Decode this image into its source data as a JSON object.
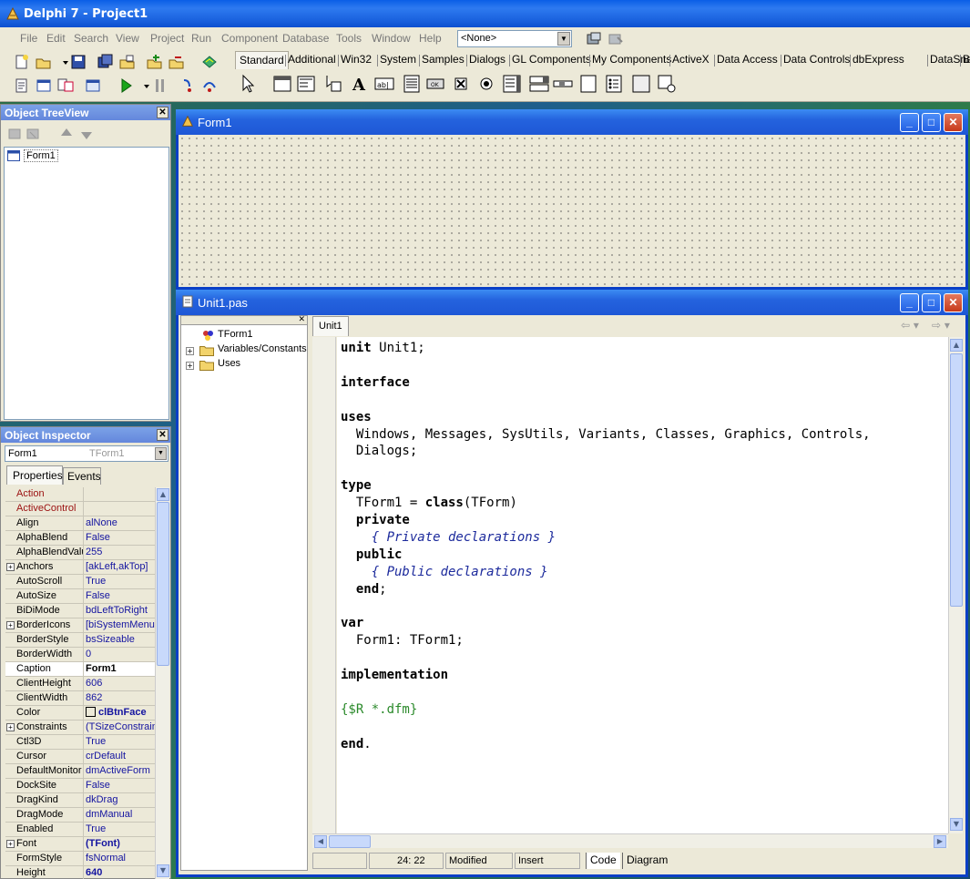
{
  "ide": {
    "title": "Delphi 7 - Project1",
    "menu": [
      "File",
      "Edit",
      "Search",
      "View",
      "Project",
      "Run",
      "Component",
      "Database",
      "Tools",
      "Window",
      "Help"
    ],
    "config_combo": "<None>",
    "palette_tabs": [
      "Standard",
      "Additional",
      "Win32",
      "System",
      "Samples",
      "Dialogs",
      "GL Components",
      "My Components",
      "ActiveX",
      "Data Access",
      "Data Controls",
      "dbExpress",
      "DataSnap",
      "B"
    ]
  },
  "tree_view": {
    "title": "Object TreeView",
    "root": "Form1"
  },
  "inspector": {
    "title": "Object Inspector",
    "object_name": "Form1",
    "object_type": "TForm1",
    "tab_properties": "Properties",
    "tab_events": "Events",
    "rows": [
      {
        "name": "Action",
        "value": "",
        "expand": false,
        "red": true
      },
      {
        "name": "ActiveControl",
        "value": "",
        "expand": false,
        "red": true
      },
      {
        "name": "Align",
        "value": "alNone",
        "expand": false
      },
      {
        "name": "AlphaBlend",
        "value": "False",
        "expand": false
      },
      {
        "name": "AlphaBlendValu",
        "value": "255",
        "expand": false
      },
      {
        "name": "Anchors",
        "value": "[akLeft,akTop]",
        "expand": true
      },
      {
        "name": "AutoScroll",
        "value": "True",
        "expand": false
      },
      {
        "name": "AutoSize",
        "value": "False",
        "expand": false
      },
      {
        "name": "BiDiMode",
        "value": "bdLeftToRight",
        "expand": false
      },
      {
        "name": "BorderIcons",
        "value": "[biSystemMenu,",
        "expand": true
      },
      {
        "name": "BorderStyle",
        "value": "bsSizeable",
        "expand": false
      },
      {
        "name": "BorderWidth",
        "value": "0",
        "expand": false
      },
      {
        "name": "Caption",
        "value": "Form1",
        "expand": false,
        "selected": true
      },
      {
        "name": "ClientHeight",
        "value": "606",
        "expand": false
      },
      {
        "name": "ClientWidth",
        "value": "862",
        "expand": false
      },
      {
        "name": "Color",
        "value": "clBtnFace",
        "expand": false,
        "bold": true,
        "swatch": true
      },
      {
        "name": "Constraints",
        "value": "(TSizeConstrain",
        "expand": true
      },
      {
        "name": "Ctl3D",
        "value": "True",
        "expand": false
      },
      {
        "name": "Cursor",
        "value": "crDefault",
        "expand": false
      },
      {
        "name": "DefaultMonitor",
        "value": "dmActiveForm",
        "expand": false
      },
      {
        "name": "DockSite",
        "value": "False",
        "expand": false
      },
      {
        "name": "DragKind",
        "value": "dkDrag",
        "expand": false
      },
      {
        "name": "DragMode",
        "value": "dmManual",
        "expand": false
      },
      {
        "name": "Enabled",
        "value": "True",
        "expand": false
      },
      {
        "name": "Font",
        "value": "(TFont)",
        "expand": true,
        "bold": true
      },
      {
        "name": "FormStyle",
        "value": "fsNormal",
        "expand": false
      },
      {
        "name": "Height",
        "value": "640",
        "expand": false,
        "bold": true
      }
    ]
  },
  "form_window": {
    "title": "Form1"
  },
  "editor": {
    "title": "Unit1.pas",
    "tab": "Unit1",
    "explorer": [
      "TForm1",
      "Variables/Constants",
      "Uses"
    ],
    "status_position": "24: 22",
    "status_modified": "Modified",
    "status_mode": "Insert",
    "tab_code": "Code",
    "tab_diagram": "Diagram",
    "lines": [
      {
        "parts": [
          {
            "t": "unit",
            "c": "kw"
          },
          {
            "t": " Unit1;",
            "c": ""
          }
        ]
      },
      {
        "parts": []
      },
      {
        "parts": [
          {
            "t": "interface",
            "c": "kw"
          }
        ]
      },
      {
        "parts": []
      },
      {
        "parts": [
          {
            "t": "uses",
            "c": "kw"
          }
        ]
      },
      {
        "parts": [
          {
            "t": "  Windows, Messages, SysUtils, Variants, Classes, Graphics, Controls,",
            "c": ""
          }
        ]
      },
      {
        "parts": [
          {
            "t": "  Dialogs;",
            "c": ""
          }
        ]
      },
      {
        "parts": []
      },
      {
        "parts": [
          {
            "t": "type",
            "c": "kw"
          }
        ]
      },
      {
        "parts": [
          {
            "t": "  TForm1 = ",
            "c": ""
          },
          {
            "t": "class",
            "c": "kw"
          },
          {
            "t": "(TForm)",
            "c": ""
          }
        ]
      },
      {
        "parts": [
          {
            "t": "  ",
            "c": ""
          },
          {
            "t": "private",
            "c": "kw"
          }
        ]
      },
      {
        "parts": [
          {
            "t": "    { Private declarations }",
            "c": "cm"
          }
        ]
      },
      {
        "parts": [
          {
            "t": "  ",
            "c": ""
          },
          {
            "t": "public",
            "c": "kw"
          }
        ]
      },
      {
        "parts": [
          {
            "t": "    { Public declarations }",
            "c": "cm"
          }
        ]
      },
      {
        "parts": [
          {
            "t": "  ",
            "c": ""
          },
          {
            "t": "end",
            "c": "kw"
          },
          {
            "t": ";",
            "c": ""
          }
        ]
      },
      {
        "parts": []
      },
      {
        "parts": [
          {
            "t": "var",
            "c": "kw"
          }
        ]
      },
      {
        "parts": [
          {
            "t": "  Form1: TForm1;",
            "c": ""
          }
        ]
      },
      {
        "parts": []
      },
      {
        "parts": [
          {
            "t": "implementation",
            "c": "kw"
          }
        ]
      },
      {
        "parts": []
      },
      {
        "parts": [
          {
            "t": "{$R *.dfm}",
            "c": "dir"
          }
        ]
      },
      {
        "parts": []
      },
      {
        "parts": [
          {
            "t": "end",
            "c": "kw"
          },
          {
            "t": ".",
            "c": ""
          }
        ]
      }
    ]
  },
  "colors": {
    "title_blue": "#0a5ee6",
    "comment": "#1c2a9c",
    "directive": "#2b8a2b",
    "inspector_value": "#1414a0",
    "inspector_red": "#9b1010"
  }
}
